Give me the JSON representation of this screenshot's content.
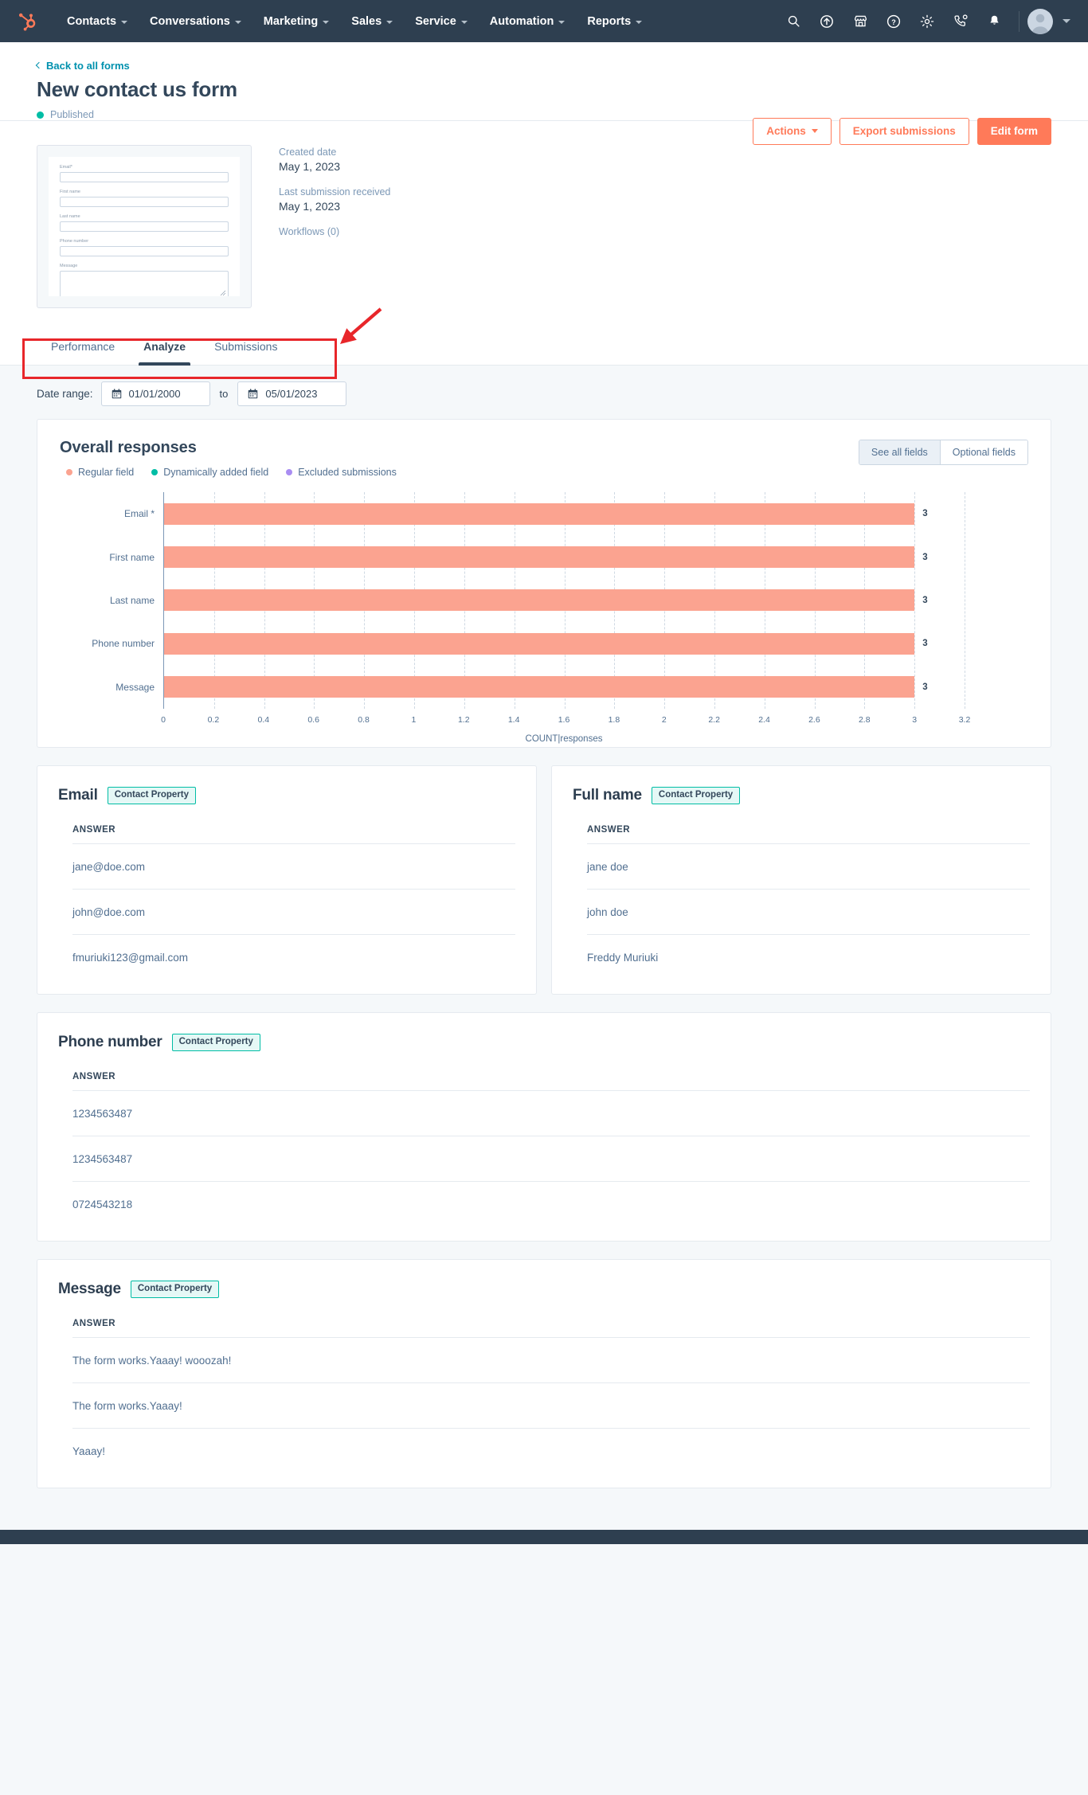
{
  "navbar": {
    "logo_name": "hubspot-logo",
    "menu": [
      {
        "label": "Contacts"
      },
      {
        "label": "Conversations"
      },
      {
        "label": "Marketing"
      },
      {
        "label": "Sales"
      },
      {
        "label": "Service"
      },
      {
        "label": "Automation"
      },
      {
        "label": "Reports"
      }
    ],
    "icons": [
      "search-icon",
      "upgrade-arrow-icon",
      "marketplace-icon",
      "help-icon",
      "gear-icon",
      "calling-icon",
      "notifications-bell-icon"
    ],
    "avatar_name": "avatar"
  },
  "header": {
    "back_link": "Back to all forms",
    "title": "New contact us form",
    "status": "Published",
    "status_color": "#00bda5",
    "actions_label": "Actions",
    "export_label": "Export submissions",
    "edit_label": "Edit form",
    "accent_color": "#ff7a59"
  },
  "preview": {
    "fields": [
      {
        "label": "Email*",
        "type": "input"
      },
      {
        "label": "First name",
        "type": "input"
      },
      {
        "label": "Last name",
        "type": "input"
      },
      {
        "label": "Phone number",
        "type": "input"
      },
      {
        "label": "Message",
        "type": "textarea"
      }
    ]
  },
  "meta": {
    "created_label": "Created date",
    "created_value": "May 1, 2023",
    "last_submission_label": "Last submission received",
    "last_submission_value": "May 1, 2023",
    "workflows_label": "Workflows (0)"
  },
  "tabs": {
    "items": [
      {
        "label": "Performance",
        "active": false
      },
      {
        "label": "Analyze",
        "active": true
      },
      {
        "label": "Submissions",
        "active": false
      }
    ]
  },
  "annotation": {
    "color": "#e8262a",
    "shape": "rectangle-with-arrow"
  },
  "date_range": {
    "label": "Date range:",
    "start": "01/01/2000",
    "separator": "to",
    "end": "05/01/2023"
  },
  "chart_card": {
    "title": "Overall responses",
    "legend": [
      {
        "label": "Regular field",
        "color": "#fba390"
      },
      {
        "label": "Dynamically added field",
        "color": "#00bda5"
      },
      {
        "label": "Excluded submissions",
        "color": "#a98df2"
      }
    ],
    "segmented": [
      {
        "label": "See all fields",
        "selected": true
      },
      {
        "label": "Optional fields",
        "selected": false
      }
    ]
  },
  "chart_data": {
    "type": "bar",
    "orientation": "horizontal",
    "title": "Overall responses",
    "categories": [
      "Email *",
      "First name",
      "Last name",
      "Phone number",
      "Message"
    ],
    "values": [
      3,
      3,
      3,
      3,
      3
    ],
    "data_labels": [
      "3",
      "3",
      "3",
      "3",
      "3"
    ],
    "series": [
      {
        "name": "Regular field",
        "color": "#fba390",
        "values": [
          3,
          3,
          3,
          3,
          3
        ]
      }
    ],
    "xlabel": "COUNT|responses",
    "ylabel": "",
    "xlim": [
      0,
      3.2
    ],
    "xticks": [
      "0",
      "0.2",
      "0.4",
      "0.6",
      "0.8",
      "1",
      "1.2",
      "1.4",
      "1.6",
      "1.8",
      "2",
      "2.2",
      "2.4",
      "2.6",
      "2.8",
      "3",
      "3.2"
    ],
    "xtick_values": [
      0,
      0.2,
      0.4,
      0.6,
      0.8,
      1,
      1.2,
      1.4,
      1.6,
      1.8,
      2,
      2.2,
      2.4,
      2.6,
      2.8,
      3,
      3.2
    ],
    "grid": "vertical-dashed",
    "legend_position": "top-left",
    "bar_color": "#fba390"
  },
  "answer_cards": [
    {
      "title": "Email",
      "badge": "Contact Property",
      "column": "ANSWER",
      "rows": [
        "jane@doe.com",
        "john@doe.com",
        "fmuriuki123@gmail.com"
      ]
    },
    {
      "title": "Full name",
      "badge": "Contact Property",
      "column": "ANSWER",
      "rows": [
        "jane doe",
        "john doe",
        "Freddy Muriuki"
      ]
    },
    {
      "title": "Phone number",
      "badge": "Contact Property",
      "column": "ANSWER",
      "rows": [
        "1234563487",
        "1234563487",
        "0724543218"
      ]
    },
    {
      "title": "Message",
      "badge": "Contact Property",
      "column": "ANSWER",
      "rows": [
        "The form works.Yaaay! wooozah!",
        "The form works.Yaaay!",
        "Yaaay!"
      ]
    }
  ]
}
